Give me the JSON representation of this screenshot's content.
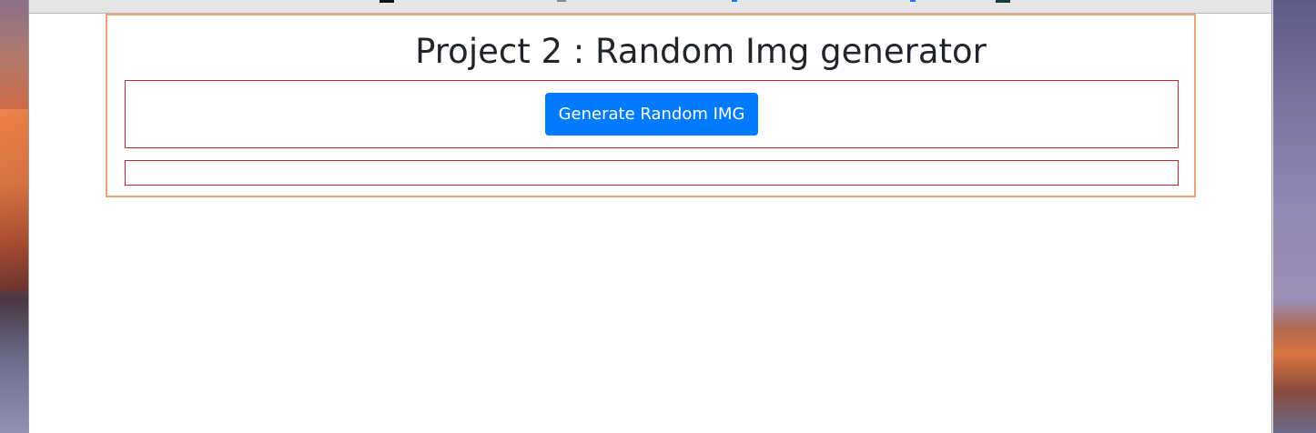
{
  "page": {
    "title": "Project 2 : Random Img generator"
  },
  "controls": {
    "generate_label": "Generate Random IMG"
  },
  "colors": {
    "button_bg": "#007bff",
    "outer_border": "#f2a07a",
    "inner_border": "#c0262c",
    "title_text": "#212529"
  }
}
